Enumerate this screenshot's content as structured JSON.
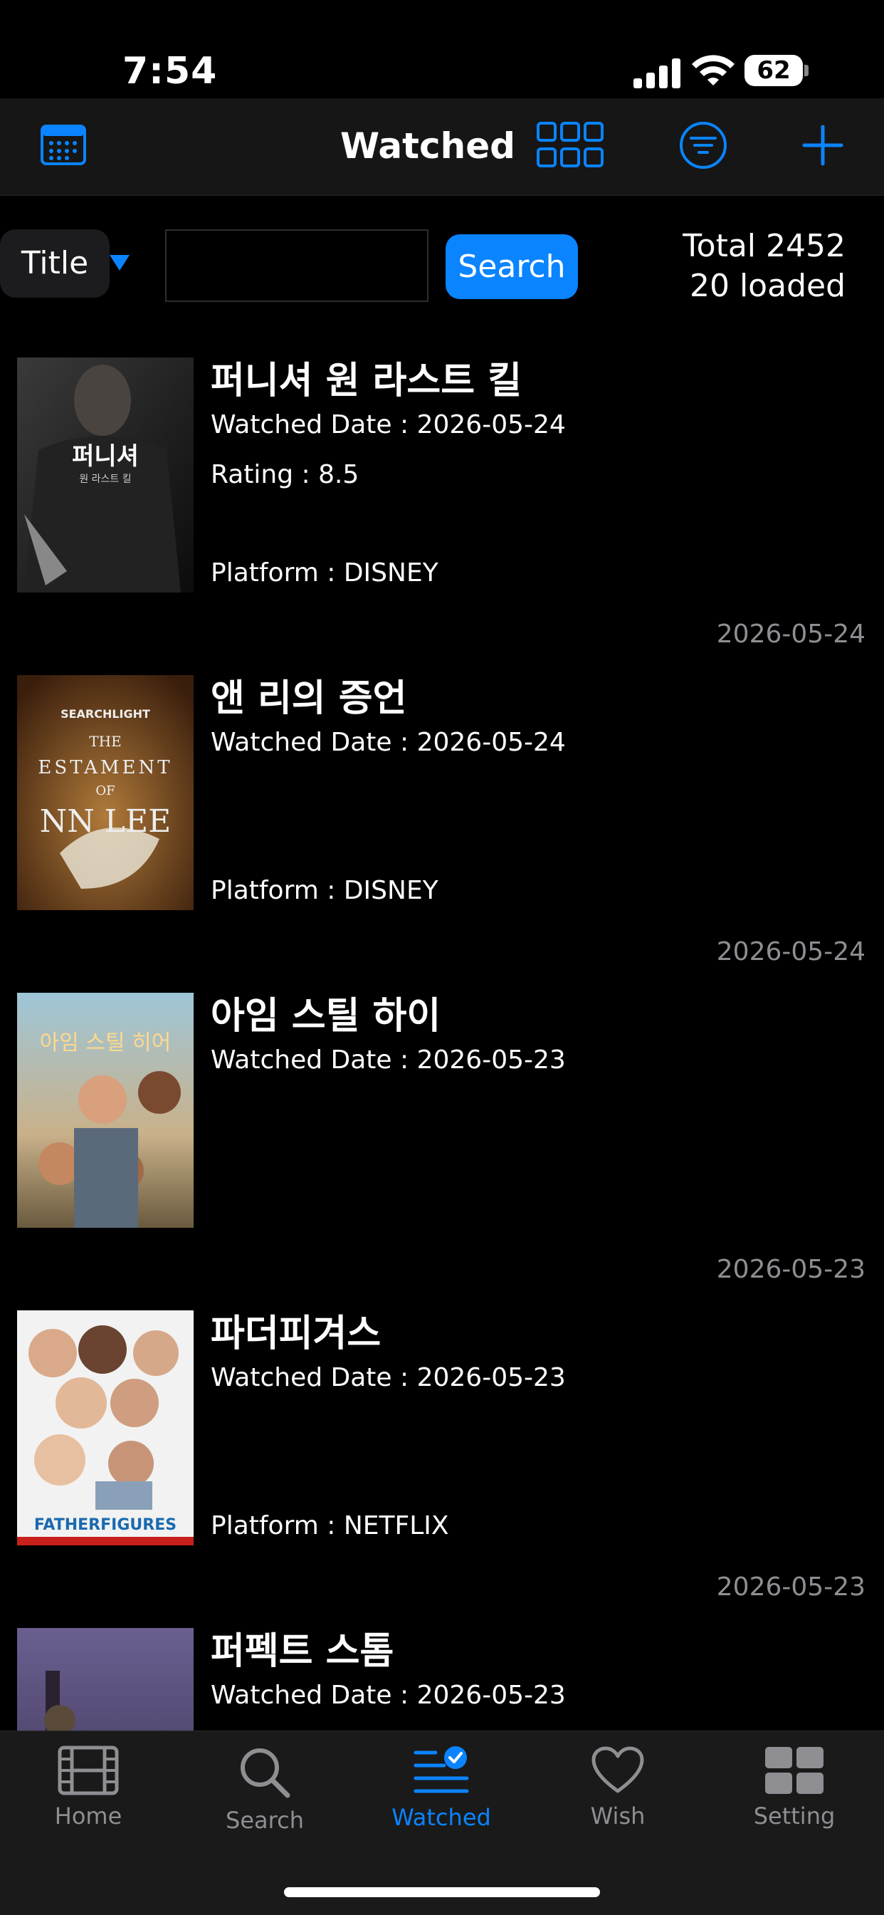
{
  "status_bar": {
    "time": "7:54",
    "battery": "62"
  },
  "nav": {
    "title": "Watched"
  },
  "search": {
    "field_label": "Title",
    "query": "",
    "button": "Search",
    "total": "Total 2452",
    "loaded": "20 loaded"
  },
  "items": [
    {
      "title": "퍼니셔 원 라스트 킬",
      "watched": "Watched Date : 2026-05-24",
      "rating": "Rating : 8.5",
      "platform": "Platform : DISNEY",
      "date": "2026-05-24",
      "poster_text_top": "퍼니셔",
      "poster_text_sub": "원 라스트 킬"
    },
    {
      "title": "앤 리의 증언",
      "watched": "Watched Date : 2026-05-24",
      "rating": "",
      "platform": "Platform : DISNEY",
      "date": "2026-05-24",
      "poster_text_top": "SEARCHLIGHT",
      "poster_text_sub": "THE",
      "poster_text_3": "ESTAMENT",
      "poster_text_4": "OF",
      "poster_text_5": "NN LEE"
    },
    {
      "title": "아임 스틸 하이",
      "watched": "Watched Date : 2026-05-23",
      "rating": "",
      "platform": "",
      "date": "2026-05-23",
      "poster_text_top": "아임 스틸 히어"
    },
    {
      "title": "파더피겨스",
      "watched": "Watched Date : 2026-05-23",
      "rating": "",
      "platform": "Platform : NETFLIX",
      "date": "2026-05-23",
      "poster_text_top": "FATHERFIGURES"
    },
    {
      "title": "퍼펙트 스톰",
      "watched": "Watched Date : 2026-05-23",
      "rating": "",
      "platform": "",
      "date": ""
    }
  ],
  "tabs": [
    {
      "label": "Home",
      "icon": "film-icon"
    },
    {
      "label": "Search",
      "icon": "magnifier-icon"
    },
    {
      "label": "Watched",
      "icon": "checklist-icon"
    },
    {
      "label": "Wish",
      "icon": "heart-icon"
    },
    {
      "label": "Setting",
      "icon": "grid-icon"
    }
  ],
  "colors": {
    "accent": "#0a84ff",
    "background": "#000000",
    "secondary_text": "#8e8e93"
  }
}
